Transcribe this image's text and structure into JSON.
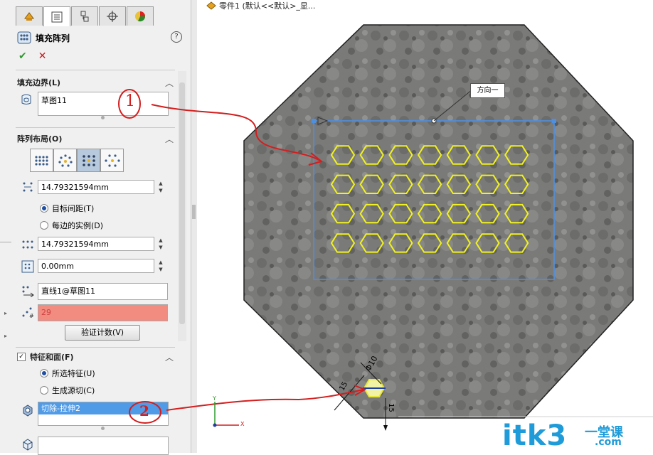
{
  "document": {
    "title": "零件1  (默认<<默认>_显..."
  },
  "feature": {
    "title": "填充阵列",
    "help": "?"
  },
  "actions": {
    "ok": "✔",
    "cancel": "✕"
  },
  "fill_boundary": {
    "label": "填充边界(L)",
    "value": "草图11"
  },
  "pattern_layout": {
    "label": "阵列布局(O)",
    "spacing": "14.79321594mm",
    "radio_target_spacing": "目标间距(T)",
    "radio_per_side": "每边的实例(D)",
    "stagger": "14.79321594mm",
    "margin": "0.00mm",
    "direction": "直线1@草图11",
    "instances": "29",
    "verify_button": "验证计数(V)"
  },
  "features_faces": {
    "label": "特征和面(F)",
    "radio_selected": "所选特征(U)",
    "radio_generate": "生成源切(C)",
    "selected_feature": "切除-拉伸2"
  },
  "annotations": {
    "mark1": "1",
    "mark2": "2"
  },
  "viewport": {
    "direction_label": "方向一",
    "dim_diameter": "Φ10",
    "dim_angle": "15",
    "dim_vertical": "15",
    "axis_x": "X",
    "axis_y": "Y"
  },
  "watermark": {
    "brand": "itk3",
    "site": "一堂课",
    "domain": ".com"
  },
  "colors": {
    "selection_blue": "#4f8fe0",
    "hex_yellow": "#f2f21e",
    "invalid_red": "#f28b80",
    "annotation_red": "#d31f1f"
  }
}
